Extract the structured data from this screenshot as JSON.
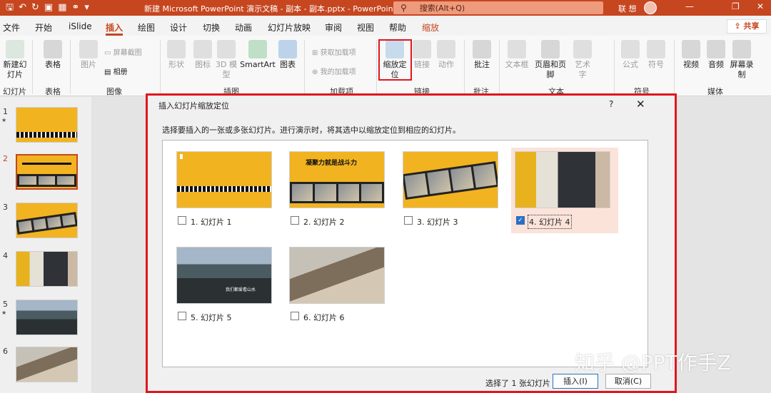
{
  "window": {
    "title": "新建 Microsoft PowerPoint 演示文稿 - 副本 - 副本.pptx  -  PowerPoint",
    "search_placeholder": "搜索(Alt+Q)",
    "user": "联 想"
  },
  "tabs": [
    "文件",
    "开始",
    "iSlide",
    "插入",
    "绘图",
    "设计",
    "切换",
    "动画",
    "幻灯片放映",
    "审阅",
    "视图",
    "帮助",
    "缩放"
  ],
  "active_tab": "插入",
  "share_label": "共享",
  "ribbon": {
    "new_slide": "新建幻灯片",
    "table": "表格",
    "picture": "图片",
    "screenshot": "屏幕截图",
    "album": "相册",
    "shapes": "形状",
    "icons": "图标",
    "model3d": "3D 模型",
    "smartart": "SmartArt",
    "chart": "图表",
    "get_addins": "获取加载项",
    "my_addins": "我的加载项",
    "zoom": "缩放定位",
    "link": "链接",
    "action": "动作",
    "comment": "批注",
    "textbox": "文本框",
    "header_footer": "页眉和页脚",
    "wordart": "艺术字",
    "equation": "公式",
    "symbol": "符号",
    "video": "视频",
    "audio": "音频",
    "record": "屏幕录制",
    "groups": [
      "幻灯片",
      "表格",
      "图像",
      "插图",
      "加载项",
      "链接",
      "批注",
      "文本",
      "符号",
      "媒体"
    ]
  },
  "slide_panel": [
    "1",
    "2",
    "3",
    "4",
    "5",
    "6"
  ],
  "dialog": {
    "title": "插入幻灯片缩放定位",
    "help": "?",
    "instruction": "选择要插入的一张或多张幻灯片。进行演示时，将其选中以缩放定位到相应的幻灯片。",
    "slides": [
      {
        "label": "1. 幻灯片 1",
        "checked": false
      },
      {
        "label": "2. 幻灯片 2",
        "checked": false
      },
      {
        "label": "3. 幻灯片 3",
        "checked": false
      },
      {
        "label": "4. 幻灯片 4",
        "checked": true
      },
      {
        "label": "5. 幻灯片 5",
        "checked": false
      },
      {
        "label": "6. 幻灯片 6",
        "checked": false
      }
    ],
    "slide_texts": {
      "s2": "凝聚力就是战斗力",
      "s5": "我们都爱看山水"
    },
    "selected_count": "选择了 1 张幻灯片",
    "insert": "插入(I)",
    "cancel": "取消(C)"
  },
  "watermark": "知乎 @PPT作手Z"
}
